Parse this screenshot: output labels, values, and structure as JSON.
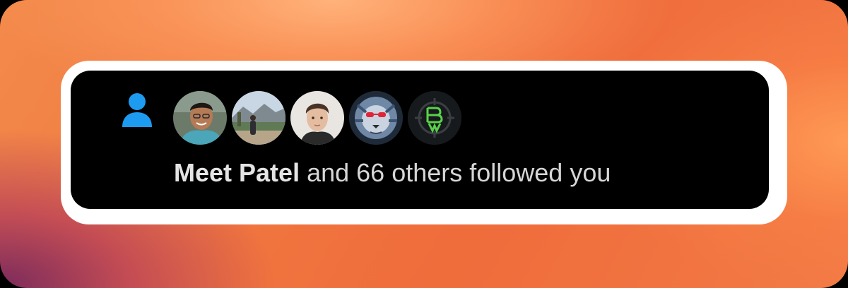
{
  "notification": {
    "type_icon": "person-icon",
    "avatars": [
      {
        "icon": "avatar-smiling-man",
        "alt": "Meet Patel"
      },
      {
        "icon": "avatar-person-outdoors"
      },
      {
        "icon": "avatar-young-man"
      },
      {
        "icon": "avatar-lion-with-glasses"
      },
      {
        "icon": "avatar-green-logo"
      }
    ],
    "name": "Meet Patel",
    "rest_text": " and 66 others followed you"
  },
  "colors": {
    "accent_blue": "#1d9bf0",
    "card_background": "#000000",
    "frame_background": "#ffffff",
    "text_primary": "#e4e4e4",
    "text_secondary": "#d6d6d6"
  }
}
